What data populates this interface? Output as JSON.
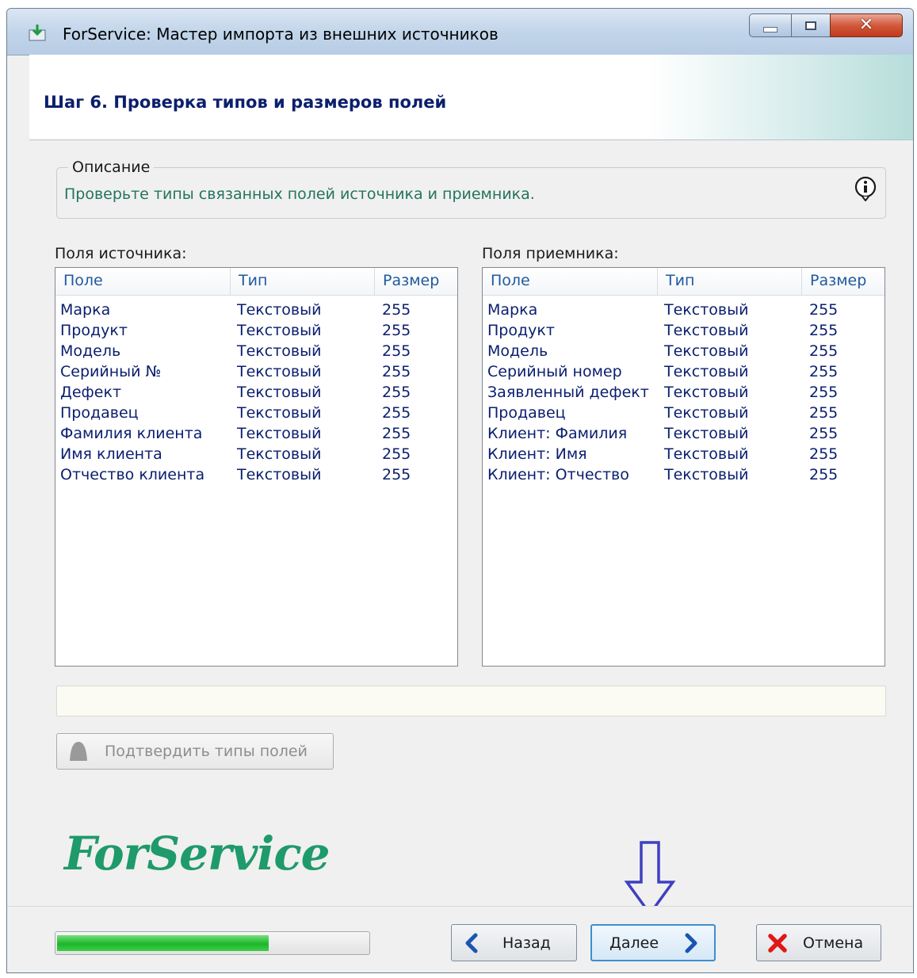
{
  "window": {
    "title": "ForService: Мастер импорта из внешних источников",
    "controls": {
      "minimize": "minimize-icon",
      "maximize": "maximize-icon",
      "close": "close-icon"
    }
  },
  "header": {
    "title": "Шаг 6. Проверка типов и размеров полей"
  },
  "description": {
    "legend": "Описание",
    "text": "Проверьте типы связанных полей источника и приемника.",
    "icon": "info-icon"
  },
  "source": {
    "label": "Поля источника:",
    "columns": [
      "Поле",
      "Тип",
      "Размер"
    ],
    "rows": [
      [
        "Марка",
        "Текстовый",
        "255"
      ],
      [
        "Продукт",
        "Текстовый",
        "255"
      ],
      [
        "Модель",
        "Текстовый",
        "255"
      ],
      [
        "Серийный №",
        "Текстовый",
        "255"
      ],
      [
        "Дефект",
        "Текстовый",
        "255"
      ],
      [
        "Продавец",
        "Текстовый",
        "255"
      ],
      [
        "Фамилия клиента",
        "Текстовый",
        "255"
      ],
      [
        "Имя клиента",
        "Текстовый",
        "255"
      ],
      [
        "Отчество клиента",
        "Текстовый",
        "255"
      ]
    ]
  },
  "target": {
    "label": "Поля приемника:",
    "columns": [
      "Поле",
      "Тип",
      "Размер"
    ],
    "rows": [
      [
        "Марка",
        "Текстовый",
        "255"
      ],
      [
        "Продукт",
        "Текстовый",
        "255"
      ],
      [
        "Модель",
        "Текстовый",
        "255"
      ],
      [
        "Серийный номер",
        "Текстовый",
        "255"
      ],
      [
        "Заявленный дефект",
        "Текстовый",
        "255"
      ],
      [
        "Продавец",
        "Текстовый",
        "255"
      ],
      [
        "Клиент: Фамилия",
        "Текстовый",
        "255"
      ],
      [
        "Клиент: Имя",
        "Текстовый",
        "255"
      ],
      [
        "Клиент: Отчество",
        "Текстовый",
        "255"
      ]
    ]
  },
  "confirm_button": {
    "label": "Подтвердить типы полей",
    "enabled": false
  },
  "logo": {
    "text": "ForService",
    "color": "#1f9a6a"
  },
  "progress": {
    "value_percent": 68
  },
  "buttons": {
    "back": "Назад",
    "next": "Далее",
    "cancel": "Отмена"
  },
  "colors": {
    "accent": "#1f5aa0",
    "row_text": "#0a1e6e",
    "desc_text": "#23745e",
    "header_title": "#0c1f6c"
  }
}
